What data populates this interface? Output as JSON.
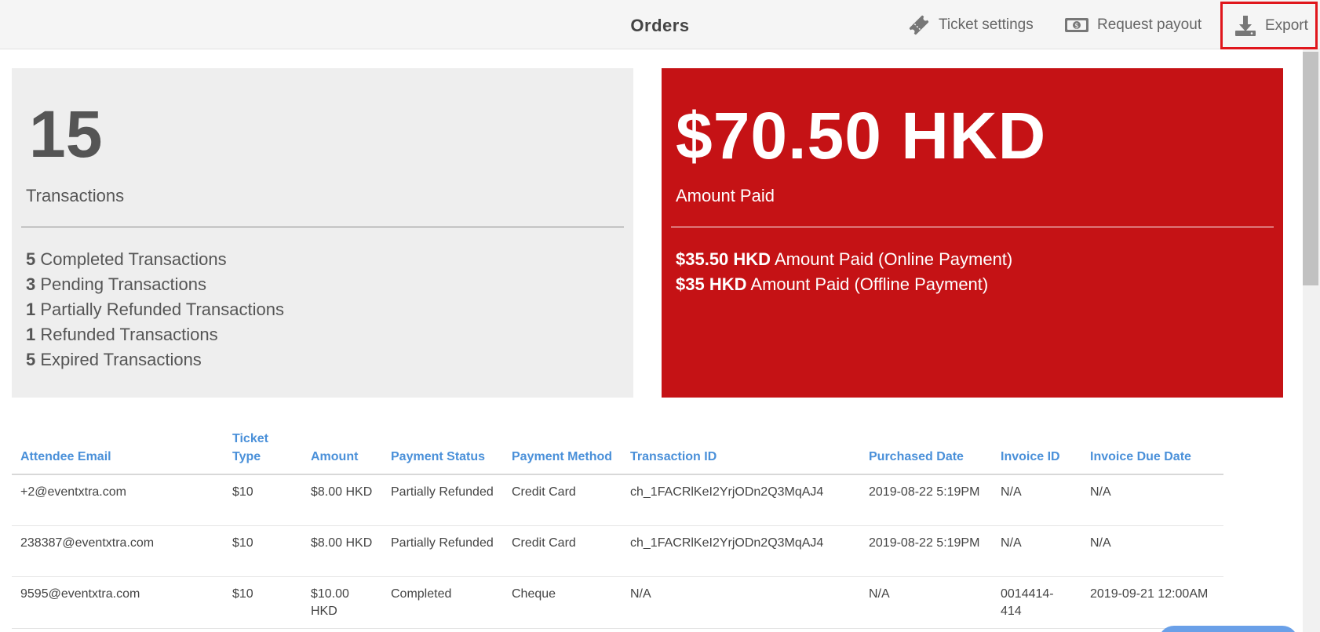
{
  "header": {
    "title": "Orders",
    "ticket_settings_label": "Ticket settings",
    "request_payout_label": "Request payout",
    "export_label": "Export",
    "icons": {
      "ticket": "ticket-icon",
      "payout": "banknote-icon",
      "export": "download-icon"
    }
  },
  "summary": {
    "transaction_count": "15",
    "transactions_label": "Transactions",
    "breakdown": [
      {
        "count": "5",
        "label": "Completed Transactions"
      },
      {
        "count": "3",
        "label": "Pending Transactions"
      },
      {
        "count": "1",
        "label": "Partially Refunded Transactions"
      },
      {
        "count": "1",
        "label": "Refunded Transactions"
      },
      {
        "count": "5",
        "label": "Expired Transactions"
      }
    ]
  },
  "payment": {
    "total_amount": "$70.50 HKD",
    "total_label": "Amount Paid",
    "breakdown": [
      {
        "amount": "$35.50 HKD",
        "label": "Amount Paid (Online Payment)"
      },
      {
        "amount": "$35 HKD",
        "label": "Amount Paid (Offline Payment)"
      }
    ]
  },
  "table": {
    "columns": [
      "Attendee Email",
      "Ticket Type",
      "Amount",
      "Payment Status",
      "Payment Method",
      "Transaction ID",
      "Purchased Date",
      "Invoice ID",
      "Invoice Due Date"
    ],
    "rows": [
      [
        "+2@eventxtra.com",
        "$10",
        "$8.00 HKD",
        "Partially Refunded",
        "Credit Card",
        "ch_1FACRlKeI2YrjODn2Q3MqAJ4",
        "2019-08-22 5:19PM",
        "N/A",
        "N/A"
      ],
      [
        "238387@eventxtra.com",
        "$10",
        "$8.00 HKD",
        "Partially Refunded",
        "Credit Card",
        "ch_1FACRlKeI2YrjODn2Q3MqAJ4",
        "2019-08-22 5:19PM",
        "N/A",
        "N/A"
      ],
      [
        "9595@eventxtra.com",
        "$10",
        "$10.00 HKD",
        "Completed",
        "Cheque",
        "N/A",
        "N/A",
        "0014414-414",
        "2019-09-21 12:00AM"
      ]
    ]
  },
  "colors": {
    "accent_red": "#c51215",
    "header_link_blue": "#4a90d9",
    "highlight_border": "#e0161c"
  }
}
